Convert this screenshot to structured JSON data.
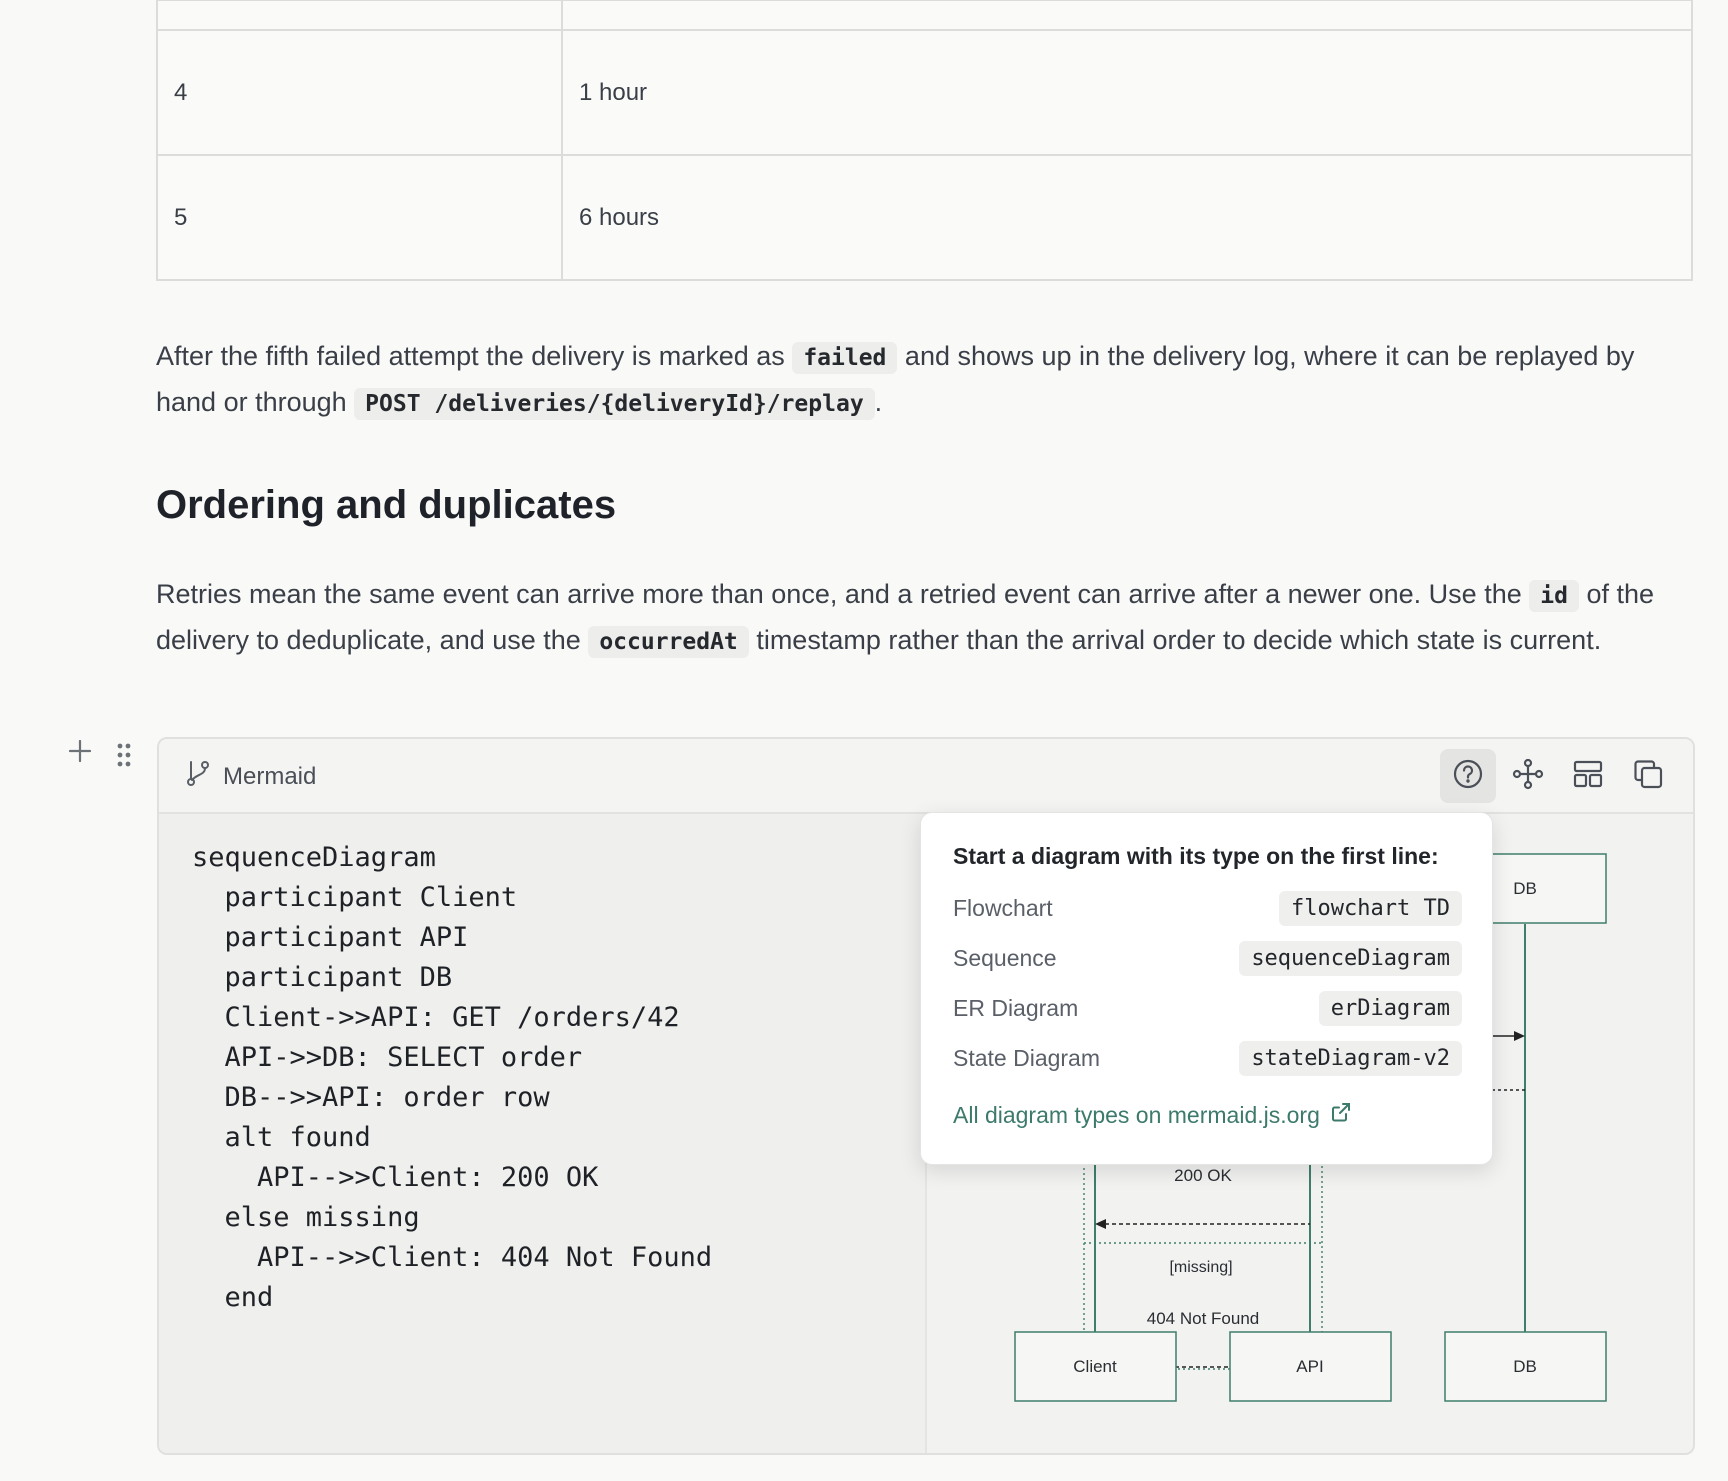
{
  "retry_table": {
    "rows": [
      {
        "attempt": "",
        "delay": ""
      },
      {
        "attempt": "4",
        "delay": "1 hour"
      },
      {
        "attempt": "5",
        "delay": "6 hours"
      }
    ]
  },
  "paragraph1": {
    "before": "After the fifth failed attempt the delivery is marked as",
    "code1": "failed",
    "middle": "and shows up in the delivery log, where it can be replayed by hand or through",
    "code2": "POST /deliveries/{deliveryId}/replay",
    "after": "."
  },
  "heading": "Ordering and duplicates",
  "paragraph2": {
    "before": "Retries mean the same event can arrive more than once, and a retried event can arrive after a newer one. Use the",
    "code1": "id",
    "middle": "of the delivery to deduplicate, and use the",
    "code2": "occurredAt",
    "after": "timestamp rather than the arrival order to decide which state is current."
  },
  "gutter": {
    "add_icon": "plus-icon",
    "drag_icon": "drag-handle-icon"
  },
  "mermaid_block": {
    "language_label": "Mermaid",
    "language_icon": "git-branch-icon",
    "toolbar": [
      {
        "name": "help-button",
        "icon": "help-circle-icon",
        "active": true
      },
      {
        "name": "diagram-view-button",
        "icon": "diagram-icon"
      },
      {
        "name": "layout-button",
        "icon": "layout-icon"
      },
      {
        "name": "copy-button",
        "icon": "copy-icon"
      }
    ],
    "code": "sequenceDiagram\n  participant Client\n  participant API\n  participant DB\n  Client->>API: GET /orders/42\n  API->>DB: SELECT order\n  DB-->>API: order row\n  alt found\n    API-->>Client: 200 OK\n  else missing\n    API-->>Client: 404 Not Found\n  end"
  },
  "preview": {
    "participants_bottom": [
      "Client",
      "API",
      "DB"
    ],
    "participant_top_visible": "DB",
    "messages_visible": [
      "200 OK",
      "404 Not Found"
    ],
    "alt_else_label": "[missing]"
  },
  "popover": {
    "title": "Start a diagram with its type on the first line:",
    "items": [
      {
        "label": "Flowchart",
        "code": "flowchart TD"
      },
      {
        "label": "Sequence",
        "code": "sequenceDiagram"
      },
      {
        "label": "ER Diagram",
        "code": "erDiagram"
      },
      {
        "label": "State Diagram",
        "code": "stateDiagram-v2"
      }
    ],
    "link_label": "All diagram types on mermaid.js.org",
    "link_icon": "external-link-icon"
  },
  "colors": {
    "accent_link": "#3d7a6c",
    "diagram_line": "#3f7e6c"
  }
}
